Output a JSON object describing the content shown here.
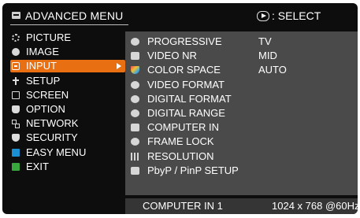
{
  "header": {
    "title": "ADVANCED MENU",
    "title_icon": "menu-icon",
    "select_icon": "select-enter-icon",
    "select_label": ": SELECT"
  },
  "left_menu": {
    "items": [
      {
        "label": "PICTURE",
        "icon": "picture-icon"
      },
      {
        "label": "IMAGE",
        "icon": "image-icon"
      },
      {
        "label": "INPUT",
        "icon": "input-icon",
        "selected": true
      },
      {
        "label": "SETUP",
        "icon": "setup-icon"
      },
      {
        "label": "SCREEN",
        "icon": "screen-icon"
      },
      {
        "label": "OPTION",
        "icon": "option-icon"
      },
      {
        "label": "NETWORK",
        "icon": "network-icon"
      },
      {
        "label": "SECURITY",
        "icon": "security-icon"
      },
      {
        "label": "EASY MENU",
        "icon": "easy-menu-icon"
      },
      {
        "label": "EXIT",
        "icon": "exit-icon"
      }
    ]
  },
  "input_menu": {
    "items": [
      {
        "label": "PROGRESSIVE",
        "value": "TV",
        "icon": "progressive-icon"
      },
      {
        "label": "VIDEO NR",
        "value": "MID",
        "icon": "video-nr-icon"
      },
      {
        "label": "COLOR SPACE",
        "value": "AUTO",
        "icon": "color-space-icon"
      },
      {
        "label": "VIDEO FORMAT",
        "value": "",
        "icon": "video-format-icon"
      },
      {
        "label": "DIGITAL FORMAT",
        "value": "",
        "icon": "digital-format-icon"
      },
      {
        "label": "DIGITAL RANGE",
        "value": "",
        "icon": "digital-range-icon"
      },
      {
        "label": "COMPUTER IN",
        "value": "",
        "icon": "computer-in-icon"
      },
      {
        "label": "FRAME LOCK",
        "value": "",
        "icon": "frame-lock-icon"
      },
      {
        "label": "RESOLUTION",
        "value": "",
        "icon": "resolution-icon"
      },
      {
        "label": "PbyP / PinP SETUP",
        "value": "",
        "icon": "pbyp-pinp-icon"
      }
    ]
  },
  "footer": {
    "source": "COMPUTER IN 1",
    "signal": "1024 x 768 @60Hz"
  },
  "colors": {
    "background": "#0d0d0d",
    "panel": "#4a4a4a",
    "highlight": "#e86f12",
    "text": "#ffffff"
  }
}
